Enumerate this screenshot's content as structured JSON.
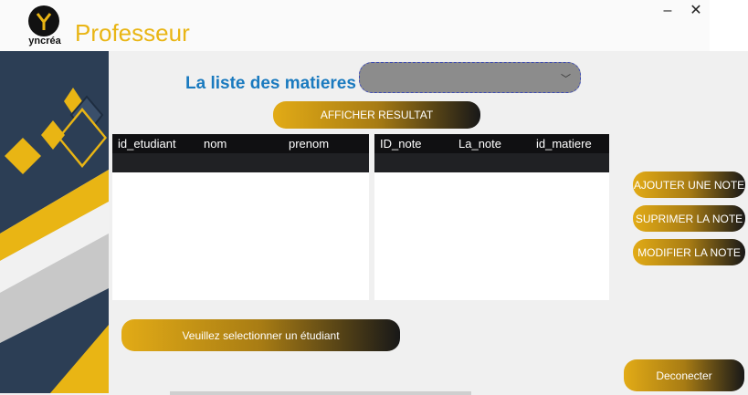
{
  "window": {
    "title": "Professeur",
    "logo_text": "yncréa",
    "logo_letter": "Y",
    "minimize": "–",
    "close": "✕"
  },
  "main": {
    "list_title": "La liste des matieres",
    "combo_value": "",
    "show_results_label": "AFFICHER RESULTAT",
    "select_student_label": "Veuillez selectionner un étudiant"
  },
  "students_table": {
    "columns": [
      "id_etudiant",
      "nom",
      "prenom"
    ],
    "rows": []
  },
  "notes_table": {
    "columns": [
      "ID_note",
      "La_note",
      "id_matiere"
    ],
    "rows": []
  },
  "actions": {
    "add_label": "AJOUTER UNE  NOTE",
    "delete_label": "SUPRIMER LA NOTE",
    "edit_label": "MODIFIER LA NOTE",
    "logout_label": "Deconecter"
  },
  "colors": {
    "accent_gold": "#e9b514",
    "title_blue": "#1a7abf",
    "header_dark": "#101012",
    "panel_navy": "#2c3e55"
  }
}
